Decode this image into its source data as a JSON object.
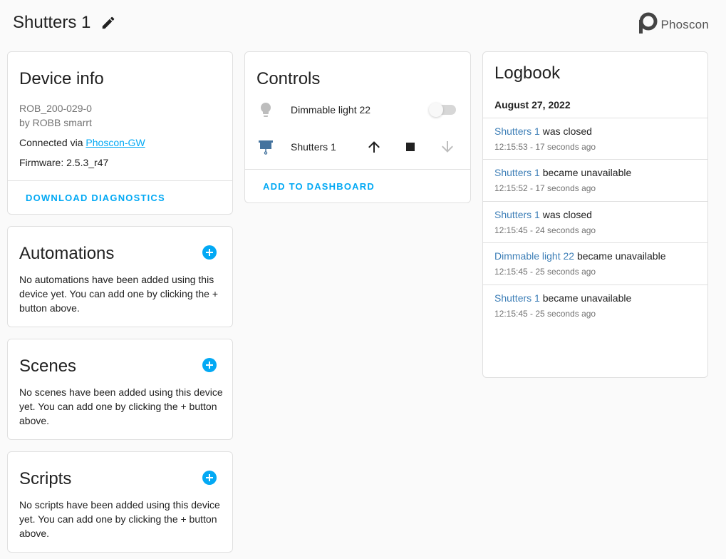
{
  "page": {
    "title": "Shutters 1",
    "brand": "Phoscon"
  },
  "device_info": {
    "title": "Device info",
    "model": "ROB_200-029-0",
    "manufacturer": "by ROBB smarrt",
    "connected_prefix": "Connected via ",
    "connected_link": "Phoscon-GW",
    "firmware": "Firmware: 2.5.3_r47",
    "download_label": "DOWNLOAD DIAGNOSTICS"
  },
  "automations": {
    "title": "Automations",
    "description": "No automations have been added using this device yet. You can add one by clicking the + button above."
  },
  "scenes": {
    "title": "Scenes",
    "description": "No scenes have been added using this device yet. You can add one by clicking the + button above."
  },
  "scripts": {
    "title": "Scripts",
    "description": "No scripts have been added using this device yet. You can add one by clicking the + button above."
  },
  "controls": {
    "title": "Controls",
    "entities": [
      {
        "name": "Dimmable light 22",
        "icon": "lightbulb-icon",
        "state": "off"
      },
      {
        "name": "Shutters 1",
        "icon": "window-shutter-icon"
      }
    ],
    "add_to_dashboard_label": "ADD TO DASHBOARD"
  },
  "logbook": {
    "title": "Logbook",
    "date": "August 27, 2022",
    "entries": [
      {
        "entity": "Shutters 1",
        "message": " was closed",
        "time": "12:15:53 - 17 seconds ago"
      },
      {
        "entity": "Shutters 1",
        "message": " became unavailable",
        "time": "12:15:52 - 17 seconds ago"
      },
      {
        "entity": "Shutters 1",
        "message": " was closed",
        "time": "12:15:45 - 24 seconds ago"
      },
      {
        "entity": "Dimmable light 22",
        "message": " became unavailable",
        "time": "12:15:45 - 25 seconds ago"
      },
      {
        "entity": "Shutters 1",
        "message": " became unavailable",
        "time": "12:15:45 - 25 seconds ago"
      }
    ]
  },
  "colors": {
    "accent": "#03a9f4",
    "entity_link": "#3e7fb7",
    "shutter_icon": "#44739e"
  }
}
